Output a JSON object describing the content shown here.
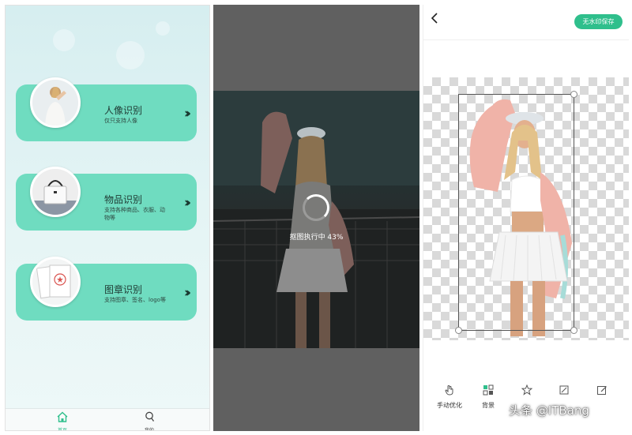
{
  "home": {
    "cards": [
      {
        "title": "人像识别",
        "subtitle": "仅只支持人像",
        "icon": "portrait-thumbnail"
      },
      {
        "title": "物品识别",
        "subtitle": "支持各种商品、衣服、动物等",
        "icon": "handbag-thumbnail"
      },
      {
        "title": "图章识别",
        "subtitle": "支持图章、签名、logo等",
        "icon": "stamp-thumbnail"
      }
    ],
    "tabs": [
      {
        "label": "首页",
        "icon": "home-icon",
        "active": true
      },
      {
        "label": "我的",
        "icon": "user-icon",
        "active": false
      }
    ],
    "accent": "#6fdcc0",
    "tab_active_color": "#2fbf8c"
  },
  "processing": {
    "status_text": "抠图执行中 43%",
    "progress": 0.43
  },
  "editor": {
    "save_label": "无水印保存",
    "back_icon": "chevron-left-icon",
    "tools": [
      {
        "label": "手动优化",
        "icon": "hand-icon"
      },
      {
        "label": "背景",
        "icon": "background-icon"
      },
      {
        "label": "",
        "icon": "sticker-icon"
      },
      {
        "label": "",
        "icon": "crop-icon"
      },
      {
        "label": "",
        "icon": "edit-icon"
      }
    ],
    "accent": "#2fbf8c"
  },
  "watermark": "头条 @ITBang"
}
